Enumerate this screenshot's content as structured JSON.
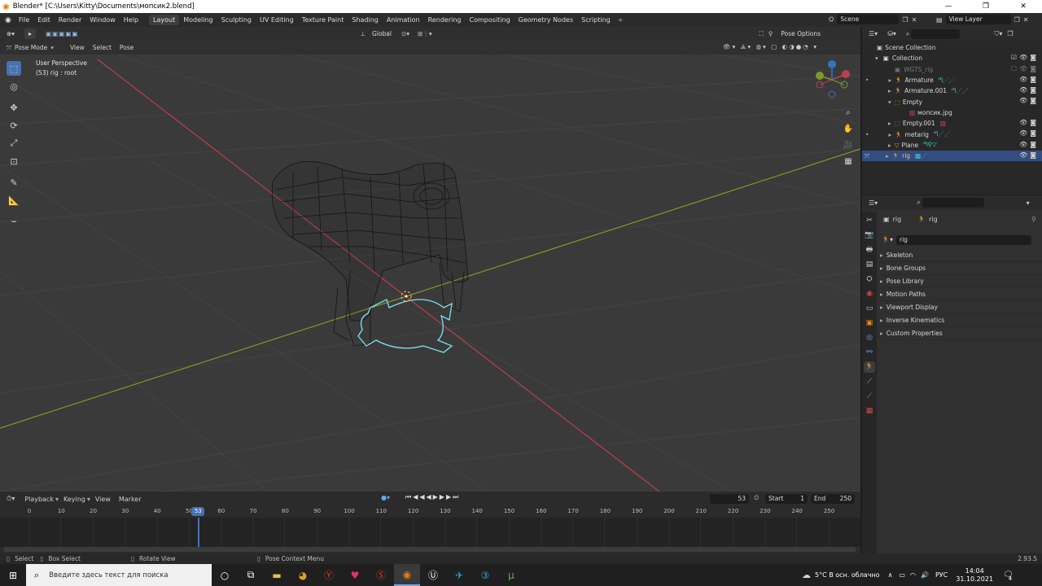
{
  "window": {
    "title": "Blender* [C:\\Users\\Kitty\\Documents\\мопсик2.blend]"
  },
  "menu": [
    "File",
    "Edit",
    "Render",
    "Window",
    "Help"
  ],
  "workspaces": [
    "Layout",
    "Modeling",
    "Sculpting",
    "UV Editing",
    "Texture Paint",
    "Shading",
    "Animation",
    "Rendering",
    "Compositing",
    "Geometry Nodes",
    "Scripting"
  ],
  "active_workspace": "Layout",
  "scene": {
    "scene_name": "Scene",
    "view_layer": "View Layer"
  },
  "viewport": {
    "transform_orientation": "Global",
    "pose_options": "Pose Options",
    "mode": "Pose Mode",
    "header_menu": [
      "View",
      "Select",
      "Pose"
    ],
    "info_line1": "User Perspective",
    "info_line2": "(53) rig : root",
    "colors": {
      "x_axis": "#b8424c",
      "y_axis": "#7c9a2e",
      "bg": "#3a3a3a",
      "control": "#7fe1ef"
    }
  },
  "outliner": {
    "scene_collection": "Scene Collection",
    "items": [
      {
        "name": "Collection"
      },
      {
        "name": "WGTS_rig"
      },
      {
        "name": "Armature"
      },
      {
        "name": "Armature.001"
      },
      {
        "name": "Empty"
      },
      {
        "name": "мопсик.jpg"
      },
      {
        "name": "Empty.001"
      },
      {
        "name": "metarig"
      },
      {
        "name": "Plane"
      },
      {
        "name": "rig"
      }
    ]
  },
  "properties": {
    "object": "rig",
    "data": "rig",
    "datablock": "rig",
    "panels": [
      "Skeleton",
      "Bone Groups",
      "Pose Library",
      "Motion Paths",
      "Viewport Display",
      "Inverse Kinematics",
      "Custom Properties"
    ]
  },
  "timeline": {
    "menu": [
      "Playback",
      "Keying",
      "View",
      "Marker"
    ],
    "current_frame": "53",
    "start_label": "Start",
    "start": "1",
    "end_label": "End",
    "end": "250",
    "ticks": [
      "0",
      "10",
      "20",
      "30",
      "40",
      "50",
      "60",
      "70",
      "80",
      "90",
      "100",
      "110",
      "120",
      "130",
      "140",
      "150",
      "160",
      "170",
      "180",
      "190",
      "200",
      "210",
      "220",
      "230",
      "240",
      "250"
    ]
  },
  "statusbar": {
    "select": "Select",
    "box_select": "Box Select",
    "rotate_view": "Rotate View",
    "context_menu": "Pose Context Menu",
    "version": "2.93.5"
  },
  "taskbar": {
    "search_placeholder": "Введите здесь текст для поиска",
    "weather": "5°C  В осн. облачно",
    "lang": "РУС",
    "time": "14:04",
    "date": "31.10.2021",
    "notifications": "4"
  }
}
